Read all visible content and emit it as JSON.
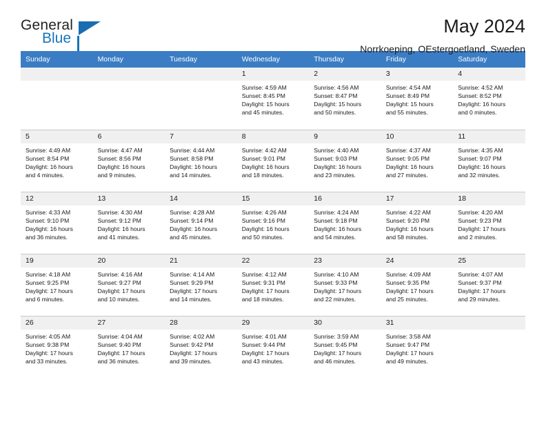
{
  "brand": {
    "name_part1": "General",
    "name_part2": "Blue",
    "logo_icon": "triangle-flag-icon"
  },
  "header": {
    "title": "May 2024",
    "subtitle": "Norrkoeping, OEstergoetland, Sweden"
  },
  "colors": {
    "header_blue": "#3b7dc4",
    "brand_blue": "#1574bb",
    "daynum_bg": "#f0f0f0",
    "grid_line": "#c8c8c8"
  },
  "weekday_headers": [
    "Sunday",
    "Monday",
    "Tuesday",
    "Wednesday",
    "Thursday",
    "Friday",
    "Saturday"
  ],
  "labels": {
    "sunrise": "Sunrise:",
    "sunset": "Sunset:",
    "daylight": "Daylight:"
  },
  "weeks": [
    [
      {
        "day": "",
        "empty": true
      },
      {
        "day": "",
        "empty": true
      },
      {
        "day": "",
        "empty": true
      },
      {
        "day": "1",
        "sunrise": "Sunrise: 4:59 AM",
        "sunset": "Sunset: 8:45 PM",
        "daylight_l1": "Daylight: 15 hours",
        "daylight_l2": "and 45 minutes."
      },
      {
        "day": "2",
        "sunrise": "Sunrise: 4:56 AM",
        "sunset": "Sunset: 8:47 PM",
        "daylight_l1": "Daylight: 15 hours",
        "daylight_l2": "and 50 minutes."
      },
      {
        "day": "3",
        "sunrise": "Sunrise: 4:54 AM",
        "sunset": "Sunset: 8:49 PM",
        "daylight_l1": "Daylight: 15 hours",
        "daylight_l2": "and 55 minutes."
      },
      {
        "day": "4",
        "sunrise": "Sunrise: 4:52 AM",
        "sunset": "Sunset: 8:52 PM",
        "daylight_l1": "Daylight: 16 hours",
        "daylight_l2": "and 0 minutes."
      }
    ],
    [
      {
        "day": "5",
        "sunrise": "Sunrise: 4:49 AM",
        "sunset": "Sunset: 8:54 PM",
        "daylight_l1": "Daylight: 16 hours",
        "daylight_l2": "and 4 minutes."
      },
      {
        "day": "6",
        "sunrise": "Sunrise: 4:47 AM",
        "sunset": "Sunset: 8:56 PM",
        "daylight_l1": "Daylight: 16 hours",
        "daylight_l2": "and 9 minutes."
      },
      {
        "day": "7",
        "sunrise": "Sunrise: 4:44 AM",
        "sunset": "Sunset: 8:58 PM",
        "daylight_l1": "Daylight: 16 hours",
        "daylight_l2": "and 14 minutes."
      },
      {
        "day": "8",
        "sunrise": "Sunrise: 4:42 AM",
        "sunset": "Sunset: 9:01 PM",
        "daylight_l1": "Daylight: 16 hours",
        "daylight_l2": "and 18 minutes."
      },
      {
        "day": "9",
        "sunrise": "Sunrise: 4:40 AM",
        "sunset": "Sunset: 9:03 PM",
        "daylight_l1": "Daylight: 16 hours",
        "daylight_l2": "and 23 minutes."
      },
      {
        "day": "10",
        "sunrise": "Sunrise: 4:37 AM",
        "sunset": "Sunset: 9:05 PM",
        "daylight_l1": "Daylight: 16 hours",
        "daylight_l2": "and 27 minutes."
      },
      {
        "day": "11",
        "sunrise": "Sunrise: 4:35 AM",
        "sunset": "Sunset: 9:07 PM",
        "daylight_l1": "Daylight: 16 hours",
        "daylight_l2": "and 32 minutes."
      }
    ],
    [
      {
        "day": "12",
        "sunrise": "Sunrise: 4:33 AM",
        "sunset": "Sunset: 9:10 PM",
        "daylight_l1": "Daylight: 16 hours",
        "daylight_l2": "and 36 minutes."
      },
      {
        "day": "13",
        "sunrise": "Sunrise: 4:30 AM",
        "sunset": "Sunset: 9:12 PM",
        "daylight_l1": "Daylight: 16 hours",
        "daylight_l2": "and 41 minutes."
      },
      {
        "day": "14",
        "sunrise": "Sunrise: 4:28 AM",
        "sunset": "Sunset: 9:14 PM",
        "daylight_l1": "Daylight: 16 hours",
        "daylight_l2": "and 45 minutes."
      },
      {
        "day": "15",
        "sunrise": "Sunrise: 4:26 AM",
        "sunset": "Sunset: 9:16 PM",
        "daylight_l1": "Daylight: 16 hours",
        "daylight_l2": "and 50 minutes."
      },
      {
        "day": "16",
        "sunrise": "Sunrise: 4:24 AM",
        "sunset": "Sunset: 9:18 PM",
        "daylight_l1": "Daylight: 16 hours",
        "daylight_l2": "and 54 minutes."
      },
      {
        "day": "17",
        "sunrise": "Sunrise: 4:22 AM",
        "sunset": "Sunset: 9:20 PM",
        "daylight_l1": "Daylight: 16 hours",
        "daylight_l2": "and 58 minutes."
      },
      {
        "day": "18",
        "sunrise": "Sunrise: 4:20 AM",
        "sunset": "Sunset: 9:23 PM",
        "daylight_l1": "Daylight: 17 hours",
        "daylight_l2": "and 2 minutes."
      }
    ],
    [
      {
        "day": "19",
        "sunrise": "Sunrise: 4:18 AM",
        "sunset": "Sunset: 9:25 PM",
        "daylight_l1": "Daylight: 17 hours",
        "daylight_l2": "and 6 minutes."
      },
      {
        "day": "20",
        "sunrise": "Sunrise: 4:16 AM",
        "sunset": "Sunset: 9:27 PM",
        "daylight_l1": "Daylight: 17 hours",
        "daylight_l2": "and 10 minutes."
      },
      {
        "day": "21",
        "sunrise": "Sunrise: 4:14 AM",
        "sunset": "Sunset: 9:29 PM",
        "daylight_l1": "Daylight: 17 hours",
        "daylight_l2": "and 14 minutes."
      },
      {
        "day": "22",
        "sunrise": "Sunrise: 4:12 AM",
        "sunset": "Sunset: 9:31 PM",
        "daylight_l1": "Daylight: 17 hours",
        "daylight_l2": "and 18 minutes."
      },
      {
        "day": "23",
        "sunrise": "Sunrise: 4:10 AM",
        "sunset": "Sunset: 9:33 PM",
        "daylight_l1": "Daylight: 17 hours",
        "daylight_l2": "and 22 minutes."
      },
      {
        "day": "24",
        "sunrise": "Sunrise: 4:09 AM",
        "sunset": "Sunset: 9:35 PM",
        "daylight_l1": "Daylight: 17 hours",
        "daylight_l2": "and 25 minutes."
      },
      {
        "day": "25",
        "sunrise": "Sunrise: 4:07 AM",
        "sunset": "Sunset: 9:37 PM",
        "daylight_l1": "Daylight: 17 hours",
        "daylight_l2": "and 29 minutes."
      }
    ],
    [
      {
        "day": "26",
        "sunrise": "Sunrise: 4:05 AM",
        "sunset": "Sunset: 9:38 PM",
        "daylight_l1": "Daylight: 17 hours",
        "daylight_l2": "and 33 minutes."
      },
      {
        "day": "27",
        "sunrise": "Sunrise: 4:04 AM",
        "sunset": "Sunset: 9:40 PM",
        "daylight_l1": "Daylight: 17 hours",
        "daylight_l2": "and 36 minutes."
      },
      {
        "day": "28",
        "sunrise": "Sunrise: 4:02 AM",
        "sunset": "Sunset: 9:42 PM",
        "daylight_l1": "Daylight: 17 hours",
        "daylight_l2": "and 39 minutes."
      },
      {
        "day": "29",
        "sunrise": "Sunrise: 4:01 AM",
        "sunset": "Sunset: 9:44 PM",
        "daylight_l1": "Daylight: 17 hours",
        "daylight_l2": "and 43 minutes."
      },
      {
        "day": "30",
        "sunrise": "Sunrise: 3:59 AM",
        "sunset": "Sunset: 9:45 PM",
        "daylight_l1": "Daylight: 17 hours",
        "daylight_l2": "and 46 minutes."
      },
      {
        "day": "31",
        "sunrise": "Sunrise: 3:58 AM",
        "sunset": "Sunset: 9:47 PM",
        "daylight_l1": "Daylight: 17 hours",
        "daylight_l2": "and 49 minutes."
      },
      {
        "day": "",
        "empty": true
      }
    ]
  ]
}
